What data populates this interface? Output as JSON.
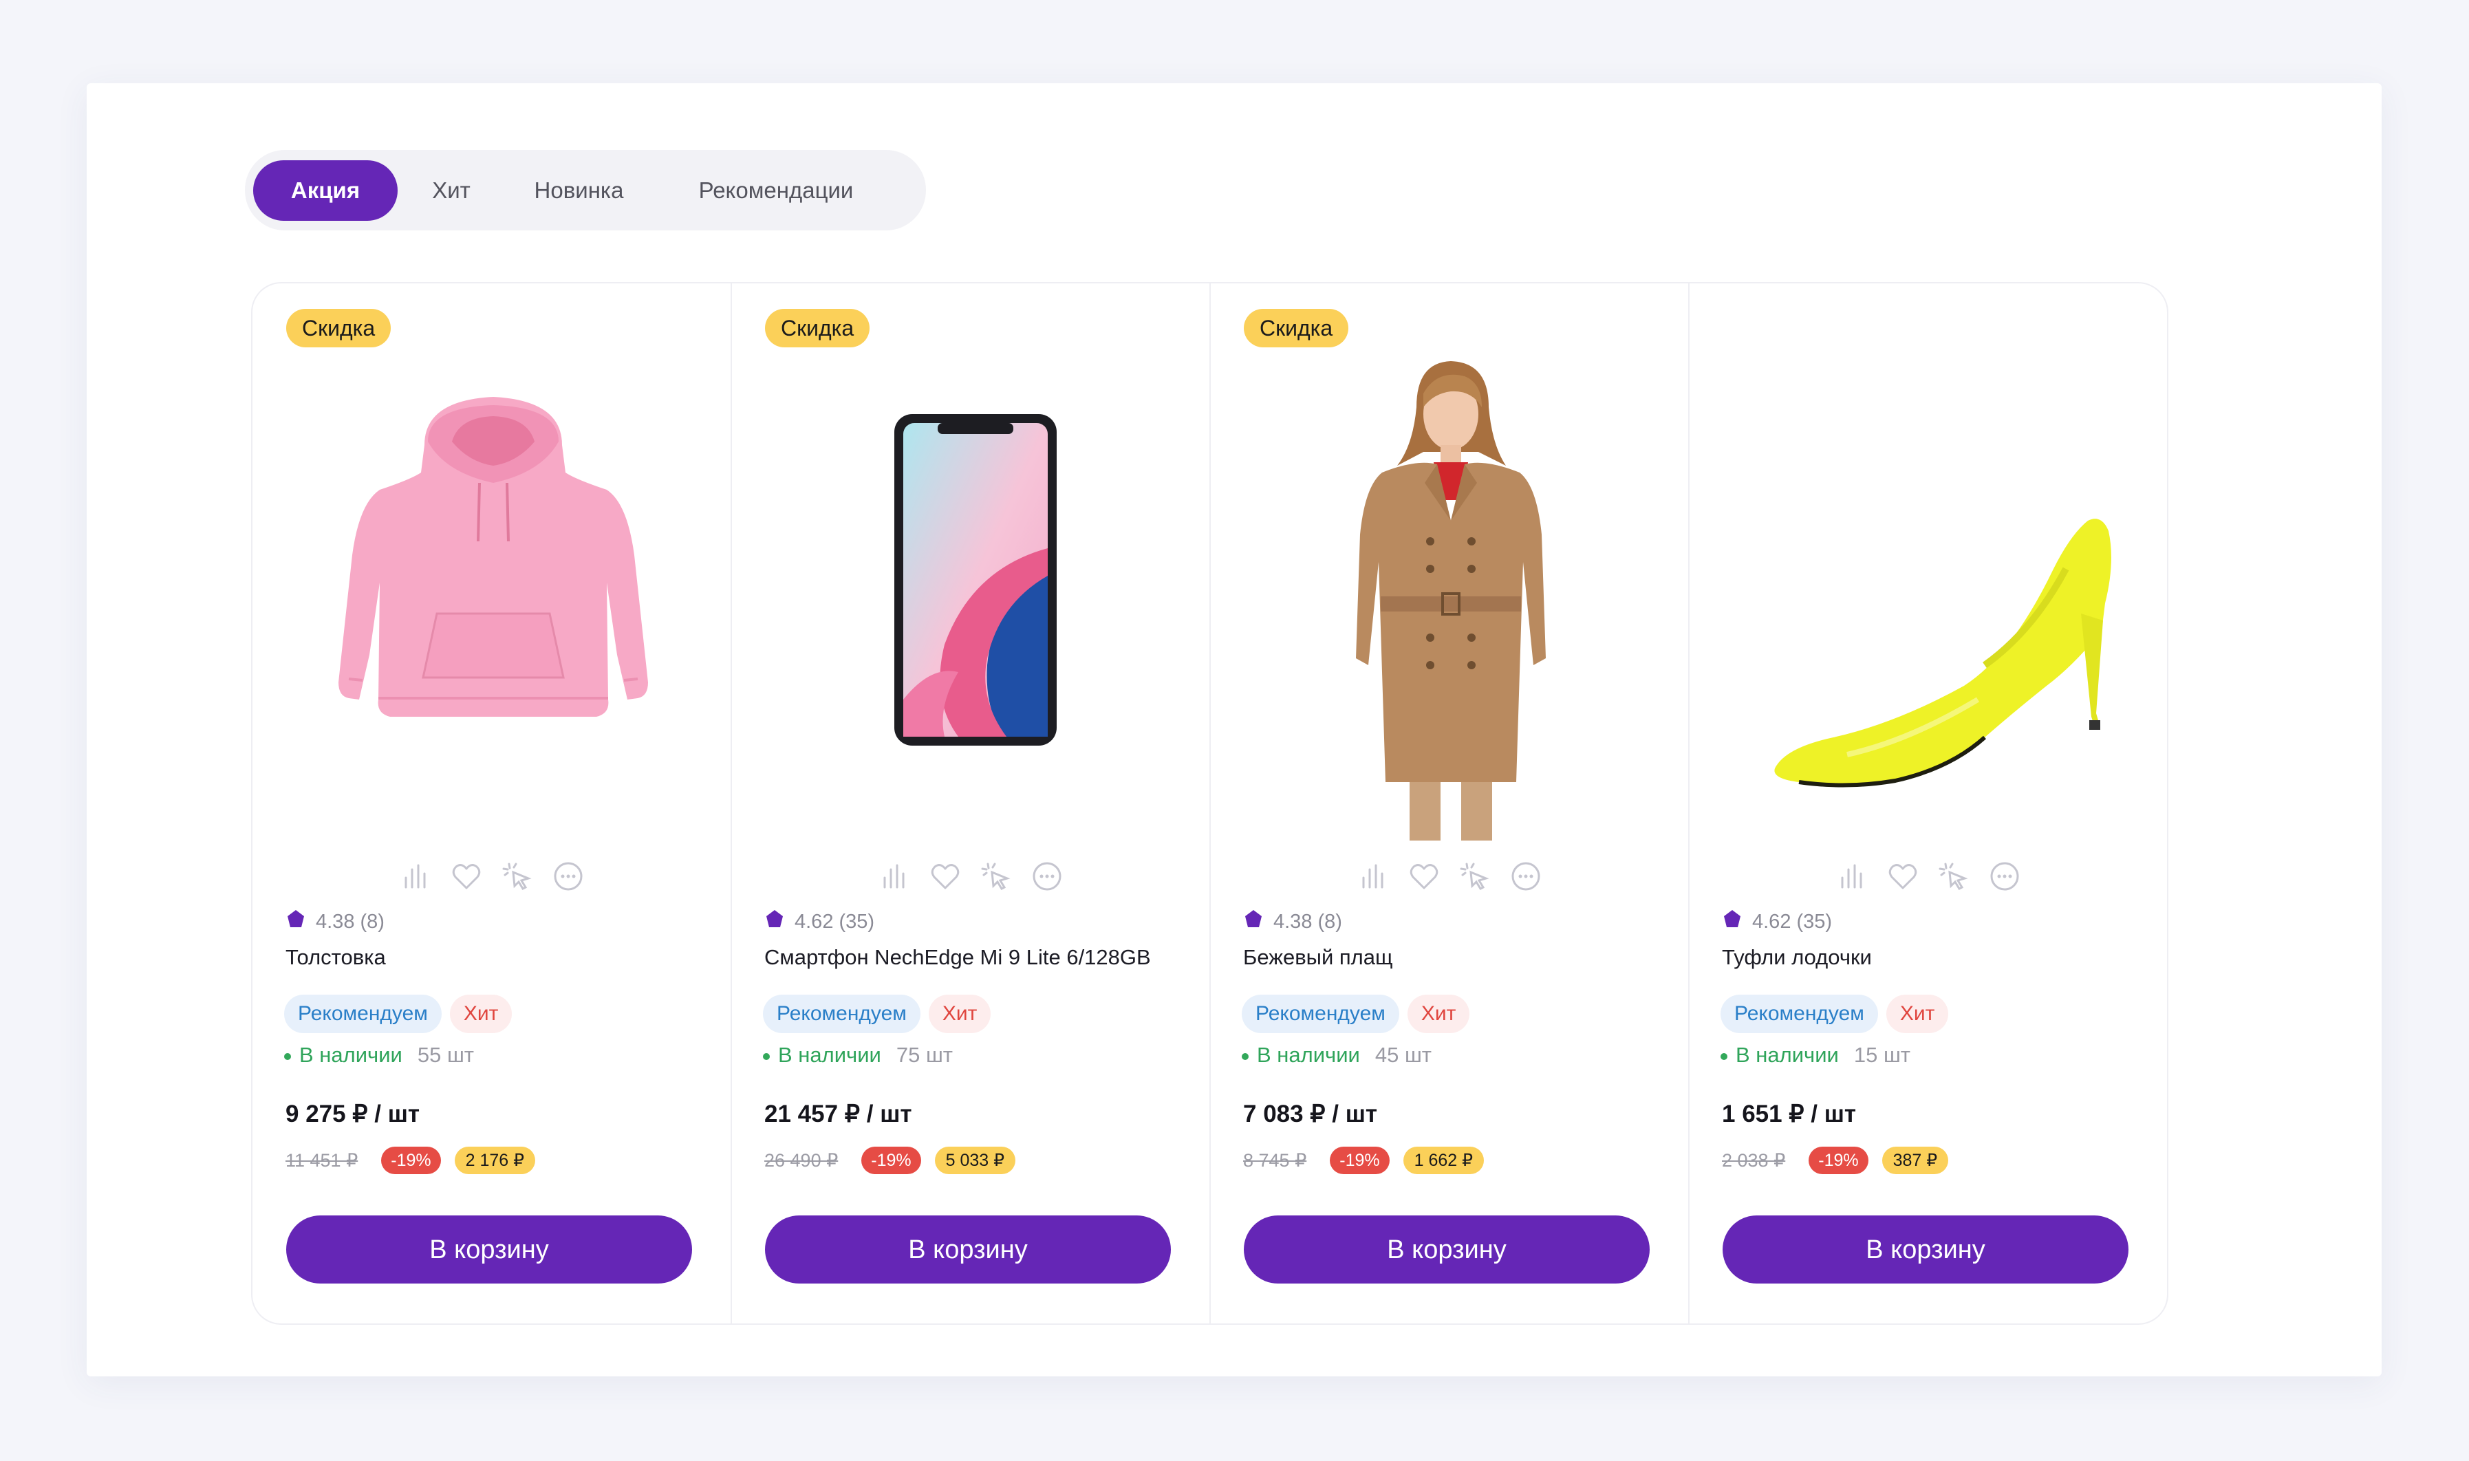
{
  "tabs": [
    "Акция",
    "Хит",
    "Новинка",
    "Рекомендации"
  ],
  "colors": {
    "accent": "#6526b6",
    "discount_badge": "#fbd059",
    "percent_badge": "#e64c45",
    "in_stock": "#2fa45a",
    "chip_recommend_bg": "#e7f0fb",
    "chip_hit_bg": "#fdeded"
  },
  "action_icons": [
    "bar-chart-icon",
    "heart-icon",
    "cursor-click-icon",
    "more-icon"
  ],
  "products": [
    {
      "discount_label": "Скидка",
      "rating": "4.38",
      "reviews": "(8)",
      "name": "Толстовка",
      "chip_recommend": "Рекомендуем",
      "chip_hit": "Хит",
      "stock_label": "В наличии",
      "stock_qty": "55 шт",
      "price": "9 275 ₽ / шт",
      "old_price": "11 451 ₽",
      "percent": "-19%",
      "saving": "2 176 ₽",
      "cart_label": "В корзину",
      "image": "pink-hoodie"
    },
    {
      "discount_label": "Скидка",
      "rating": "4.62",
      "reviews": "(35)",
      "name": "Смартфон NechEdge Mi 9 Lite 6/128GB",
      "chip_recommend": "Рекомендуем",
      "chip_hit": "Хит",
      "stock_label": "В наличии",
      "stock_qty": "75 шт",
      "price": "21 457 ₽ / шт",
      "old_price": "26 490 ₽",
      "percent": "-19%",
      "saving": "5 033 ₽",
      "cart_label": "В корзину",
      "image": "smartphone"
    },
    {
      "discount_label": "Скидка",
      "rating": "4.38",
      "reviews": "(8)",
      "name": "Бежевый плащ",
      "chip_recommend": "Рекомендуем",
      "chip_hit": "Хит",
      "stock_label": "В наличии",
      "stock_qty": "45 шт",
      "price": "7 083 ₽ / шт",
      "old_price": "8 745 ₽",
      "percent": "-19%",
      "saving": "1 662 ₽",
      "cart_label": "В корзину",
      "image": "beige-trench-coat"
    },
    {
      "discount_label": "",
      "rating": "4.62",
      "reviews": "(35)",
      "name": "Туфли лодочки",
      "chip_recommend": "Рекомендуем",
      "chip_hit": "Хит",
      "stock_label": "В наличии",
      "stock_qty": "15 шт",
      "price": "1 651 ₽ / шт",
      "old_price": "2 038 ₽",
      "percent": "-19%",
      "saving": "387 ₽",
      "cart_label": "В корзину",
      "image": "yellow-pumps"
    }
  ]
}
